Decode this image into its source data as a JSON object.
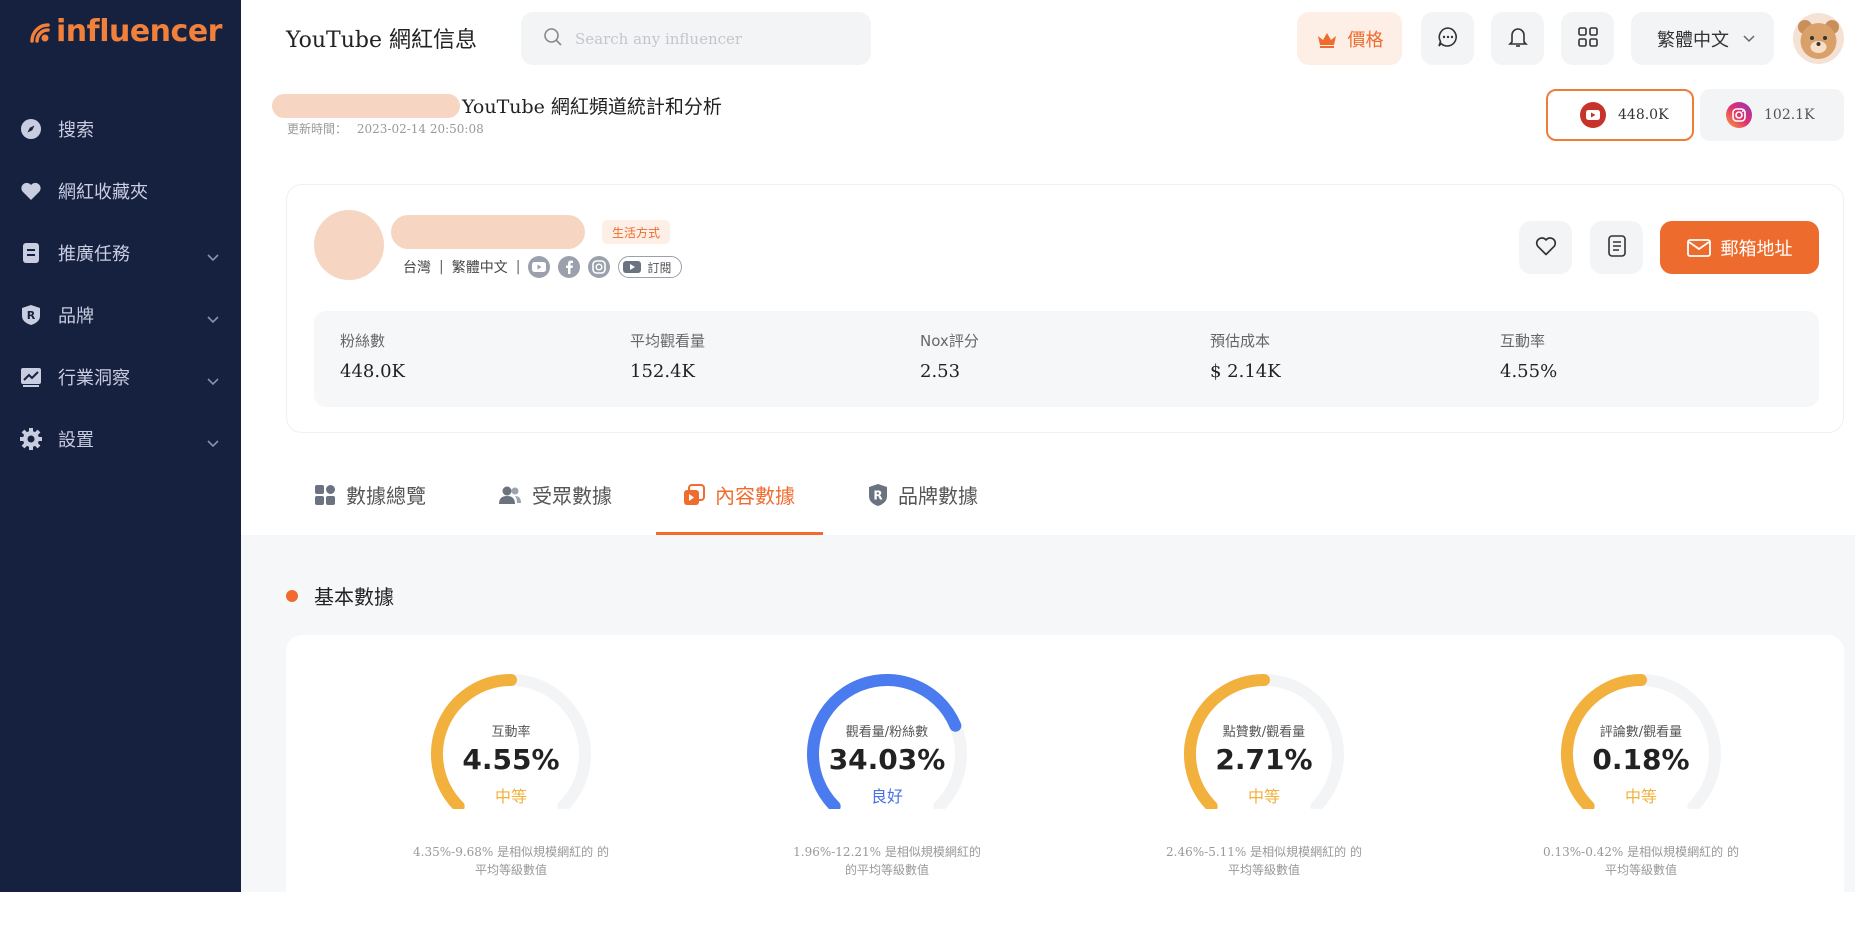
{
  "brand": {
    "name": "influencer",
    "accent": "#ef6c2e"
  },
  "sidebar": {
    "items": [
      {
        "label": "搜索",
        "icon": "compass-icon",
        "expandable": false
      },
      {
        "label": "網紅收藏夾",
        "icon": "heart-icon",
        "expandable": false
      },
      {
        "label": "推廣任務",
        "icon": "document-icon",
        "expandable": true
      },
      {
        "label": "品牌",
        "icon": "brand-r-icon",
        "expandable": true
      },
      {
        "label": "行業洞察",
        "icon": "chart-icon",
        "expandable": true
      },
      {
        "label": "設置",
        "icon": "gear-icon",
        "expandable": true
      }
    ]
  },
  "header": {
    "title": "YouTube 網紅信息",
    "search_placeholder": "Search any influencer",
    "price_label": "價格",
    "language": "繁體中文"
  },
  "channel": {
    "title": "YouTube 網紅頻道統計和分析",
    "updated_label": "更新時間：",
    "updated_value": "2023-02-14 20:50:08",
    "platforms": [
      {
        "name": "YouTube",
        "value": "448.0K",
        "active": true
      },
      {
        "name": "Instagram",
        "value": "102.1K",
        "active": false
      }
    ]
  },
  "profile": {
    "category_tag": "生活方式",
    "country": "台灣",
    "language": "繁體中文",
    "subscribe_label": "訂閱",
    "email_button": "郵箱地址",
    "stats": [
      {
        "label": "粉絲數",
        "value": "448.0K"
      },
      {
        "label": "平均觀看量",
        "value": "152.4K"
      },
      {
        "label": "Nox評分",
        "value": "2.53"
      },
      {
        "label": "預估成本",
        "value": "$ 2.14K"
      },
      {
        "label": "互動率",
        "value": "4.55%"
      }
    ]
  },
  "tabs": [
    {
      "label": "數據總覽",
      "icon": "grid-icon",
      "active": false
    },
    {
      "label": "受眾數據",
      "icon": "users-icon",
      "active": false
    },
    {
      "label": "內容數據",
      "icon": "content-icon",
      "active": true
    },
    {
      "label": "品牌數據",
      "icon": "brand-shield-icon",
      "active": false
    }
  ],
  "basic": {
    "section_title": "基本數據",
    "metrics": [
      {
        "label": "互動率",
        "value": "4.55%",
        "level": "中等",
        "level_color": "#f2b03d",
        "arc_color": "#f2b03d",
        "fill": 0.5,
        "note_line1": "4.35%-9.68% 是相似規模網紅的 的",
        "note_line2": "平均等級數值"
      },
      {
        "label": "觀看量/粉絲數",
        "value": "34.03%",
        "level": "良好",
        "level_color": "#4a72e8",
        "arc_color": "#4a7cf0",
        "fill": 0.75,
        "note_line1": "1.96%-12.21% 是相似規模網紅的",
        "note_line2": "的平均等級數值"
      },
      {
        "label": "點贊數/觀看量",
        "value": "2.71%",
        "level": "中等",
        "level_color": "#f2b03d",
        "arc_color": "#f2b03d",
        "fill": 0.5,
        "note_line1": "2.46%-5.11% 是相似規模網紅的 的",
        "note_line2": "平均等級數值"
      },
      {
        "label": "評論數/觀看量",
        "value": "0.18%",
        "level": "中等",
        "level_color": "#f2b03d",
        "arc_color": "#f2b03d",
        "fill": 0.5,
        "note_line1": "0.13%-0.42% 是相似規模網紅的 的",
        "note_line2": "平均等級數值"
      }
    ]
  }
}
